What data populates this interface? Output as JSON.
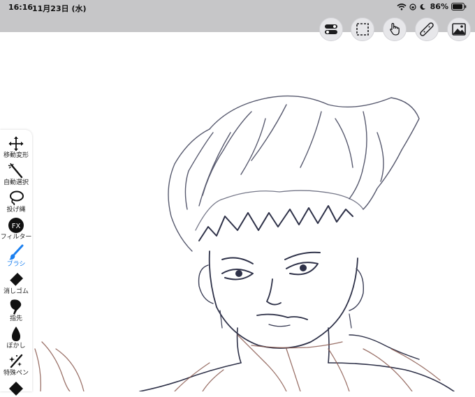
{
  "status": {
    "time": "16:16",
    "date": "11月23日 (水)",
    "battery": "86%"
  },
  "top_buttons": [
    {
      "name": "settings-toggle-button",
      "icon": "toggle-icon"
    },
    {
      "name": "selection-button",
      "icon": "dashed-square-icon"
    },
    {
      "name": "gesture-button",
      "icon": "hand-touch-icon"
    },
    {
      "name": "ruler-button",
      "icon": "ruler-icon"
    },
    {
      "name": "gallery-button",
      "icon": "image-icon"
    }
  ],
  "tools": [
    {
      "label": "移動変形",
      "icon": "move-arrows-icon",
      "active": false
    },
    {
      "label": "自動選択",
      "icon": "magic-wand-icon",
      "active": false
    },
    {
      "label": "投げ縄",
      "icon": "lasso-icon",
      "active": false
    },
    {
      "label": "フィルター",
      "icon": "fx-icon",
      "active": false
    },
    {
      "label": "ブラシ",
      "icon": "brush-icon",
      "active": true
    },
    {
      "label": "消しゴム",
      "icon": "eraser-icon",
      "active": false
    },
    {
      "label": "指先",
      "icon": "finger-smudge-icon",
      "active": false
    },
    {
      "label": "ぼかし",
      "icon": "blur-drop-icon",
      "active": false
    },
    {
      "label": "特殊ペン",
      "icon": "sparkle-pen-icon",
      "active": false
    }
  ],
  "colors": {
    "accent": "#1a7ff0",
    "statusbar": "#c6c6c8",
    "sketch_dark": "#3a3d55",
    "sketch_brown": "#8a5a50"
  }
}
